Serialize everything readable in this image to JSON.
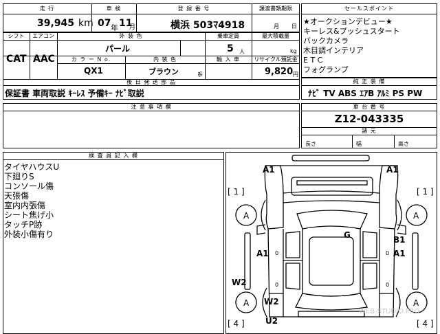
{
  "header": {
    "mileage_label": "走 行",
    "inspection_label": "車 検",
    "registration_label": "登 録 番 号",
    "transfer_label": "譲渡書類期限",
    "mileage_value": "39,945",
    "mileage_unit": "km",
    "inspection_year": "07",
    "inspection_year_unit": "年",
    "inspection_month": "11",
    "inspection_month_unit": "月",
    "registration_value": "横浜 503ﾏ4918",
    "transfer_month_unit": "月",
    "transfer_day_unit": "日"
  },
  "spec": {
    "shift_label": "シフト",
    "aircon_label": "エアコン",
    "exterior_color_label": "外 装 色",
    "capacity_label": "乗車定員",
    "max_load_label": "最大積載量",
    "shift_value": "CAT",
    "aircon_value": "AAC",
    "exterior_color_value": "パール",
    "capacity_value": "5",
    "capacity_unit": "人",
    "load_unit": "kg",
    "color_no_label": "カ ラ ー N o.",
    "interior_color_label": "内 装 色",
    "import_label": "輸 入 車",
    "recycle_label": "リサイクル預託金",
    "color_no_value": "QX1",
    "interior_color_value": "ブラウン",
    "interior_suffix": "系",
    "recycle_value": "9,820",
    "recycle_unit": "円",
    "later_parts_label": "後 日 発 送 部 品",
    "later_parts_value": "保証書 車両取説 ｷｰﾚｽ 予備ｷｰ ﾅﾋﾞ取説"
  },
  "sales_points": {
    "label": "セールスポイント",
    "items": [
      "★オークションデビュー★",
      "キーレス&プッシュスタート",
      "バックカメラ",
      "木目調インテリア",
      "E T C",
      "フォグランプ"
    ]
  },
  "equipment": {
    "label": "純 正 装 備",
    "value": "ﾅﾋﾞ TV ABS ｴｱB ｱﾙﾐ PS PW"
  },
  "notes": {
    "label": "注 意 事 項 欄"
  },
  "chassis": {
    "label": "車 台 番 号",
    "value": "Z12-043335",
    "dims_label": "諸 元",
    "length": "長さ",
    "width": "幅",
    "height": "高さ"
  },
  "inspector": {
    "label": "検 査 員 記 入 欄",
    "items": [
      "タイヤハウスU",
      "下廻りS",
      "コンソール傷",
      "天張傷",
      "室内内張傷",
      "シート焦げ小",
      "タッチP跡",
      "外装小傷有り"
    ]
  },
  "diagram": {
    "a1_front_left": "A1",
    "a1_front_right": "A1",
    "bracket_left_top": "[ 1 ]",
    "bracket_right_top": "[ 1 ]",
    "wheel_front_left": "A",
    "wheel_front_right": "A",
    "g_mark": "G",
    "b1_mark": "B1",
    "a1_side_left": "A1",
    "a1_side_right": "A1",
    "zero_left": "0",
    "zero_right": "0",
    "zero_lower_left": "0",
    "zero_lower_right": "0",
    "w2_left": "W2",
    "w2_rear": "W2",
    "wheel_rear_left": "A",
    "wheel_rear_right": "A",
    "u2_mark": "U2",
    "bracket_left_bottom": "[ 4 ]",
    "bracket_right_bottom": "[ 4 ]",
    "watermark": "WEB-STUDIO.PRO"
  }
}
